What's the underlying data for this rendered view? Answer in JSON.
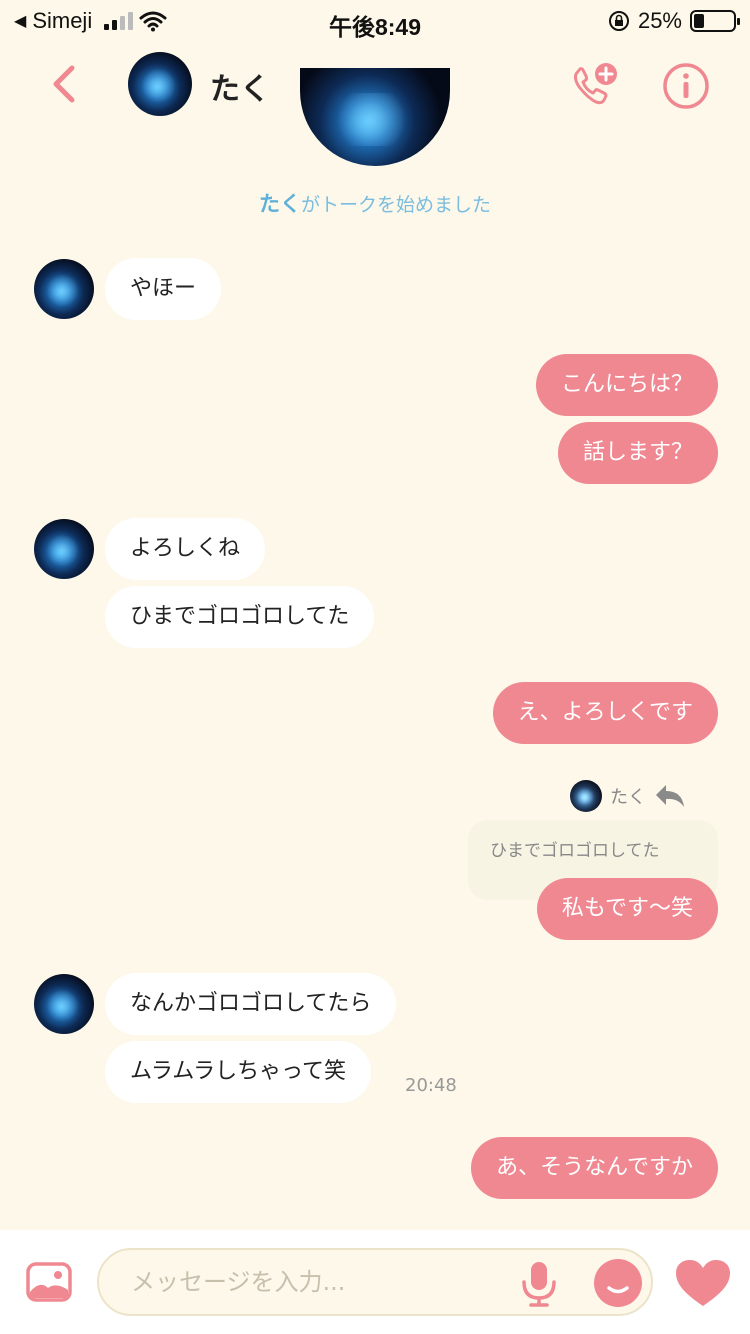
{
  "status_bar": {
    "carrier": "Simeji",
    "time": "午後8:49",
    "battery": "25%",
    "battery_level": 0.25
  },
  "header": {
    "contact_name": "たく"
  },
  "chat": {
    "start_name": "たく",
    "start_suffix": "がトークを始めました",
    "messages": [
      {
        "dir": "in",
        "text": "やほー"
      },
      {
        "dir": "out",
        "text": "こんにちは？"
      },
      {
        "dir": "out",
        "text": "話します？"
      },
      {
        "dir": "in",
        "text": "よろしくね"
      },
      {
        "dir": "in",
        "text": "ひまでゴロゴロしてた"
      },
      {
        "dir": "out",
        "text": "え、よろしくです"
      },
      {
        "dir": "out",
        "text": "私もです〜笑"
      },
      {
        "dir": "in",
        "text": "なんかゴロゴロしてたら"
      },
      {
        "dir": "in",
        "text": "ムラムラしちゃって笑"
      },
      {
        "dir": "out",
        "text": "あ、そうなんですか"
      }
    ],
    "reply": {
      "name": "たく",
      "quoted_text": "ひまでゴロゴロしてた"
    },
    "timestamp": "20:48"
  },
  "composer": {
    "placeholder": "メッセージを入力..."
  },
  "colors": {
    "accent": "#f08892",
    "background": "#fdf8e9",
    "notice": "#7bbde0"
  }
}
